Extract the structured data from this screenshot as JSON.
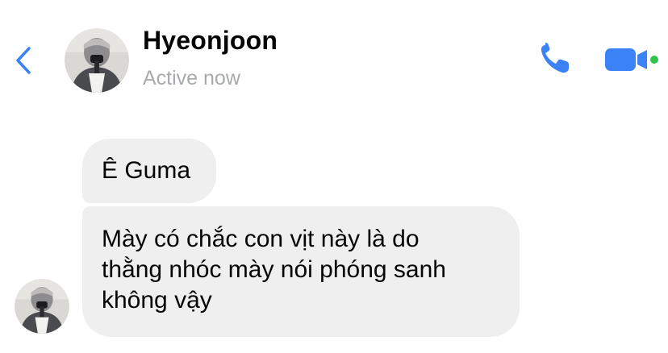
{
  "header": {
    "back_icon": "chevron-left-icon",
    "contact_name": "Hyeonjoon",
    "status": "Active now",
    "call_icon": "phone-icon",
    "video_icon": "video-camera-icon",
    "accent_color": "#3b82f6"
  },
  "messages": [
    {
      "sender": "Hyeonjoon",
      "text": "Ê Guma"
    },
    {
      "sender": "Hyeonjoon",
      "text": "Mày có chắc con vịt này là do\nthằng nhóc mày nói phóng sanh\nkhông vậy"
    }
  ],
  "colors": {
    "bubble_background": "#efeff0",
    "text": "#050505",
    "status_text": "#a8aaae"
  }
}
